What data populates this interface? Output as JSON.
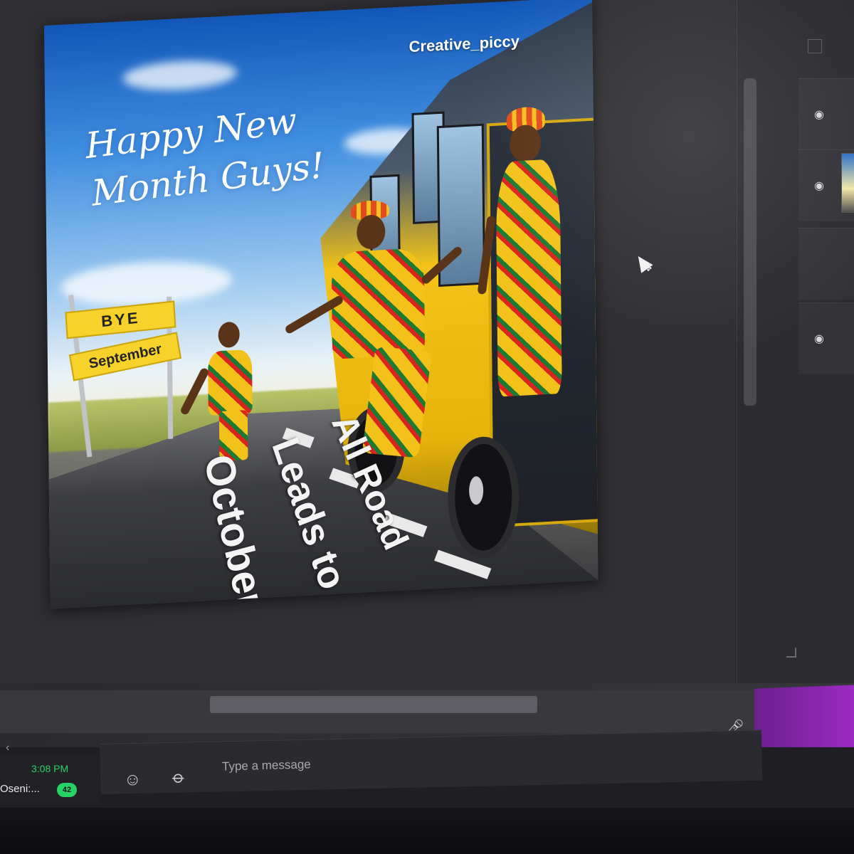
{
  "poster": {
    "watermark": "Creative_piccy",
    "title_line1": "Happy New",
    "title_line2": "Month Guys!",
    "sign_top": "BYE",
    "sign_bottom": "September",
    "road_line1": "All Road",
    "road_line2": "Leads to",
    "road_line3": "October"
  },
  "chat": {
    "preview_time": "3:08 PM",
    "preview_name": "Oseni:...",
    "unread_count": "42",
    "message_placeholder": "Type a message"
  },
  "colors": {
    "accent_green": "#25d366",
    "taskbar_purple": "#9a2bc4",
    "sign_yellow": "#f6d22a"
  },
  "icons": {
    "emoji": "smiley-icon",
    "attach": "paperclip-icon",
    "mic": "microphone-icon",
    "layer_visibility": "eye-icon"
  }
}
